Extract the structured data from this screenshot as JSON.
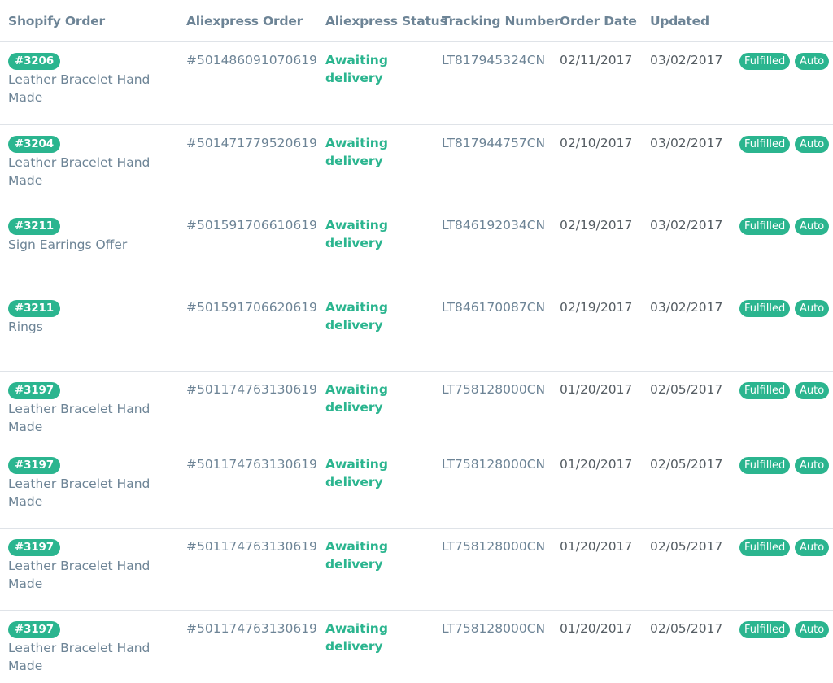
{
  "table": {
    "columns": {
      "shopify_order": "Shopify Order",
      "aliexpress_order": "Aliexpress Order",
      "aliexpress_status": "Aliexpress Status",
      "tracking_number": "Tracking Number",
      "order_date": "Order Date",
      "updated": "Updated"
    },
    "rows": [
      {
        "order": "#3206",
        "product": "Leather Bracelet Hand Made",
        "ali_order": "#501486091070619",
        "status": "Awaiting delivery",
        "tracking": "LT817945324CN",
        "order_date": "02/11/2017",
        "updated": "03/02/2017",
        "fulfilled": "Fulfilled",
        "auto": "Auto"
      },
      {
        "order": "#3204",
        "product": "Leather Bracelet Hand Made",
        "ali_order": "#501471779520619",
        "status": "Awaiting delivery",
        "tracking": "LT817944757CN",
        "order_date": "02/10/2017",
        "updated": "03/02/2017",
        "fulfilled": "Fulfilled",
        "auto": "Auto"
      },
      {
        "order": "#3211",
        "product": "Sign Earrings Offer",
        "ali_order": "#501591706610619",
        "status": "Awaiting delivery",
        "tracking": "LT846192034CN",
        "order_date": "02/19/2017",
        "updated": "03/02/2017",
        "fulfilled": "Fulfilled",
        "auto": "Auto"
      },
      {
        "order": "#3211",
        "product": "Rings",
        "ali_order": "#501591706620619",
        "status": "Awaiting delivery",
        "tracking": "LT846170087CN",
        "order_date": "02/19/2017",
        "updated": "03/02/2017",
        "fulfilled": "Fulfilled",
        "auto": "Auto"
      },
      {
        "order": "#3197",
        "product": "Leather Bracelet Hand Made",
        "ali_order": "#501174763130619",
        "status": "Awaiting delivery",
        "tracking": "LT758128000CN",
        "order_date": "01/20/2017",
        "updated": "02/05/2017",
        "fulfilled": "Fulfilled",
        "auto": "Auto"
      },
      {
        "order": "#3197",
        "product": "Leather Bracelet Hand Made",
        "ali_order": "#501174763130619",
        "status": "Awaiting delivery",
        "tracking": "LT758128000CN",
        "order_date": "01/20/2017",
        "updated": "02/05/2017",
        "fulfilled": "Fulfilled",
        "auto": "Auto"
      },
      {
        "order": "#3197",
        "product": "Leather Bracelet Hand Made",
        "ali_order": "#501174763130619",
        "status": "Awaiting delivery",
        "tracking": "LT758128000CN",
        "order_date": "01/20/2017",
        "updated": "02/05/2017",
        "fulfilled": "Fulfilled",
        "auto": "Auto"
      },
      {
        "order": "#3197",
        "product": "Leather Bracelet Hand Made",
        "ali_order": "#501174763130619",
        "status": "Awaiting delivery",
        "tracking": "LT758128000CN",
        "order_date": "01/20/2017",
        "updated": "02/05/2017",
        "fulfilled": "Fulfilled",
        "auto": "Auto"
      }
    ]
  },
  "colors": {
    "accent": "#2bb58f",
    "header_text": "#6d8496",
    "muted_text": "#6d8496",
    "date_text": "#555d63",
    "divider": "#dfe3e8"
  }
}
